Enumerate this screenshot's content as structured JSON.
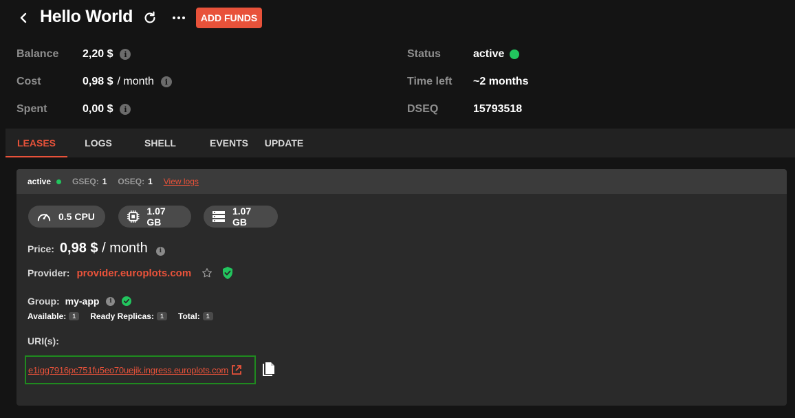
{
  "header": {
    "title": "Hello World",
    "add_funds_label": "ADD FUNDS",
    "icons": [
      "chevron-left-icon",
      "refresh-icon",
      "more-horizontal-icon"
    ]
  },
  "summary": {
    "balance_label": "Balance",
    "balance_value": "2,20 $",
    "cost_label": "Cost",
    "cost_value": "0,98 $",
    "cost_unit": "/ month",
    "spent_label": "Spent",
    "spent_value": "0,00 $",
    "status_label": "Status",
    "status_value": "active",
    "time_left_label": "Time left",
    "time_left_value": "~2 months",
    "dseq_label": "DSEQ",
    "dseq_value": "15793518"
  },
  "tabs": [
    {
      "label": "LEASES",
      "active": true
    },
    {
      "label": "LOGS",
      "active": false
    },
    {
      "label": "SHELL",
      "active": false
    },
    {
      "label": "EVENTS",
      "active": false
    },
    {
      "label": "UPDATE",
      "active": false
    }
  ],
  "lease": {
    "status": "active",
    "gseq_label": "GSEQ:",
    "gseq_value": "1",
    "oseq_label": "OSEQ:",
    "oseq_value": "1",
    "view_logs_label": "View logs",
    "resources": {
      "cpu": "0.5 CPU",
      "memory": "1.07 GB",
      "storage": "1.07 GB"
    },
    "price_label": "Price:",
    "price_value": "0,98 $",
    "price_unit": "/ month",
    "provider_label": "Provider:",
    "provider_value": "provider.europlots.com",
    "group_label": "Group:",
    "group_name": "my-app",
    "available_label": "Available:",
    "available_value": "1",
    "ready_label": "Ready Replicas:",
    "ready_value": "1",
    "total_label": "Total:",
    "total_value": "1",
    "uri_label": "URI(s):",
    "uri_value": "e1igg7916pc751fu5eo70uejik.ingress.europlots.com"
  },
  "colors": {
    "accent": "#e8523a",
    "status_active": "#22c55e",
    "background": "#141414",
    "card": "#2a2a2a",
    "highlight_border": "#1f8a1f"
  }
}
